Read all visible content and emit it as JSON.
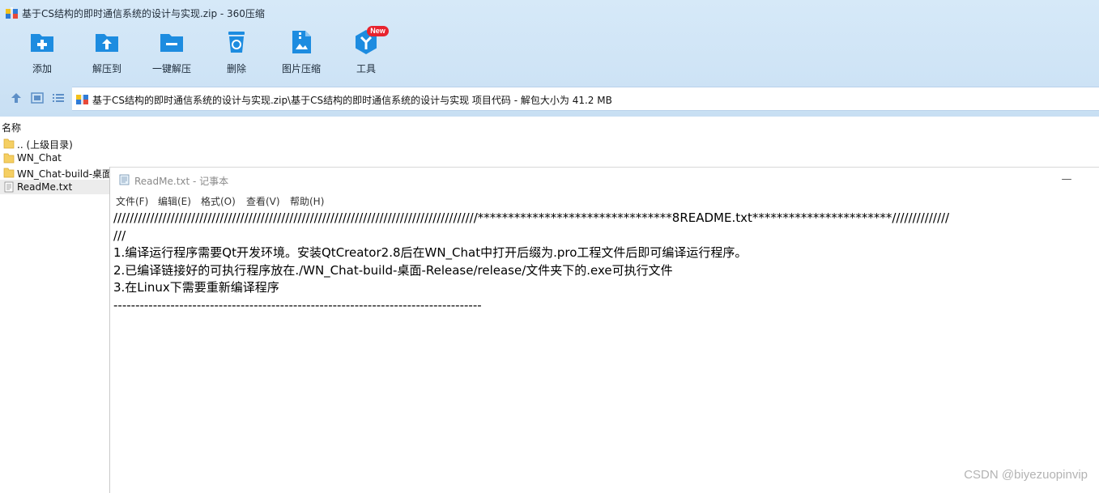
{
  "window": {
    "title": "基于CS结构的即时通信系统的设计与实现.zip - 360压缩"
  },
  "toolbar": {
    "items": [
      {
        "label": "添加",
        "icon": "add-icon"
      },
      {
        "label": "解压到",
        "icon": "extract-to-icon"
      },
      {
        "label": "一键解压",
        "icon": "one-click-extract-icon"
      },
      {
        "label": "删除",
        "icon": "delete-icon"
      },
      {
        "label": "图片压缩",
        "icon": "image-compress-icon"
      },
      {
        "label": "工具",
        "icon": "tools-icon"
      }
    ],
    "new_badge": "New"
  },
  "address": {
    "path": "基于CS结构的即时通信系统的设计与实现.zip\\基于CS结构的即时通信系统的设计与实现 项目代码 - 解包大小为 41.2 MB"
  },
  "filelist": {
    "column_name": "名称",
    "items": [
      {
        "name": ".. (上级目录)",
        "type": "folder"
      },
      {
        "name": "WN_Chat",
        "type": "folder"
      },
      {
        "name": "WN_Chat-build-桌面",
        "type": "folder"
      },
      {
        "name": "ReadMe.txt",
        "type": "text-file"
      }
    ]
  },
  "notepad": {
    "title": "ReadMe.txt - 记事本",
    "minimize": "—",
    "menu": [
      "文件(F)",
      "编辑(E)",
      "格式(O)",
      "查看(V)",
      "帮助(H)"
    ],
    "lines": [
      "/////////////////////////////////////////////////////////////////////////////////////////********************************8README.txt***********************//////////////",
      "///",
      "1.编译运行程序需要Qt开发环境。安装QtCreator2.8后在WN_Chat中打开后缀为.pro工程文件后即可编译运行程序。",
      "2.已编译链接好的可执行程序放在./WN_Chat-build-桌面-Release/release/文件夹下的.exe可执行文件",
      "3.在Linux下需要重新编译程序",
      "------------------------------------------------------------------------------------"
    ]
  },
  "watermark": "CSDN @biyezuopinvip",
  "colors": {
    "toolbar_bg": "#cfe4f6",
    "icon_blue": "#1d8ce0",
    "badge_red": "#e8232e",
    "folder_yellow": "#f5cf63"
  }
}
